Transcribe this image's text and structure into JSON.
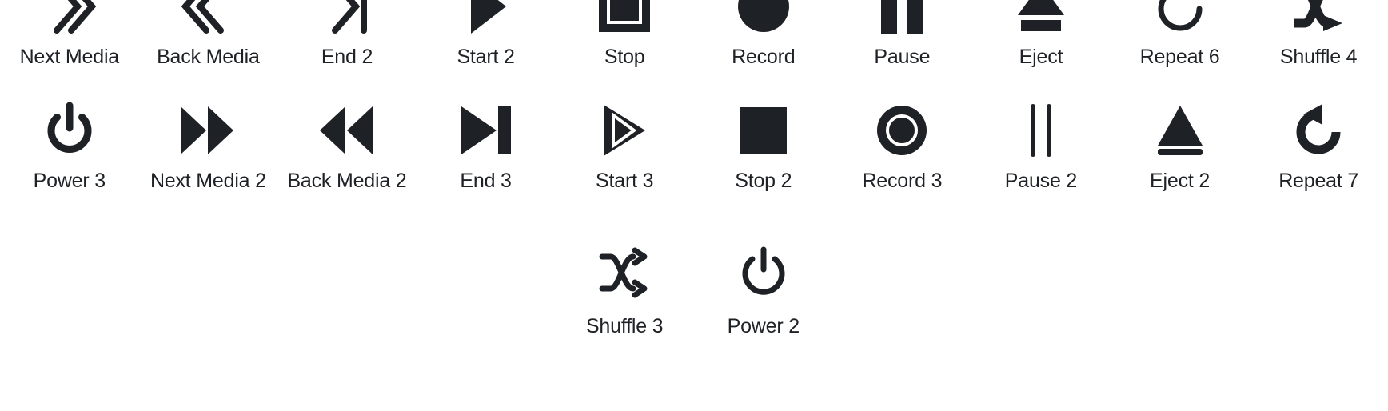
{
  "page": {
    "background_color": "#ffffff",
    "icon_color": "#1e2125",
    "label_color": "#1e2125",
    "columns": 10,
    "total_icons": 22
  },
  "rows": [
    {
      "row_index": 1,
      "cells": [
        {
          "icon": "next-media-chevron-double-right-icon",
          "label": "Next Media"
        },
        {
          "icon": "back-media-chevron-double-left-icon",
          "label": "Back Media"
        },
        {
          "icon": "end-chevron-right-bar-icon",
          "label": "End 2"
        },
        {
          "icon": "start-play-triangle-icon",
          "label": "Start 2"
        },
        {
          "icon": "stop-square-outline-inset-icon",
          "label": "Stop"
        },
        {
          "icon": "record-filled-circle-icon",
          "label": "Record"
        },
        {
          "icon": "pause-two-bars-icon",
          "label": "Pause"
        },
        {
          "icon": "eject-triangle-bar-icon",
          "label": "Eject"
        },
        {
          "icon": "repeat-counterclockwise-arrow-thin-icon",
          "label": "Repeat 6"
        },
        {
          "icon": "shuffle-crossed-arrows-bold-icon",
          "label": "Shuffle 4"
        }
      ]
    },
    {
      "row_index": 2,
      "cells": [
        {
          "icon": "power-symbol-thick-icon",
          "label": "Power 3"
        },
        {
          "icon": "next-media-double-triangle-icon",
          "label": "Next Media 2"
        },
        {
          "icon": "back-media-double-triangle-icon",
          "label": "Back Media 2"
        },
        {
          "icon": "end-triangle-bar-icon",
          "label": "End 3"
        },
        {
          "icon": "start-triangle-outline-inset-icon",
          "label": "Start 3"
        },
        {
          "icon": "stop-filled-square-icon",
          "label": "Stop 2"
        },
        {
          "icon": "record-circle-ring-inset-icon",
          "label": "Record 3"
        },
        {
          "icon": "pause-two-thin-lines-icon",
          "label": "Pause 2"
        },
        {
          "icon": "eject-tall-triangle-thin-bar-icon",
          "label": "Eject 2"
        },
        {
          "icon": "repeat-counterclockwise-arrow-bold-icon",
          "label": "Repeat 7"
        }
      ]
    },
    {
      "row_index": 3,
      "cells": [
        {
          "icon": "shuffle-crossed-arrows-thin-icon",
          "label": "Shuffle 3"
        },
        {
          "icon": "power-symbol-thin-icon",
          "label": "Power 2"
        }
      ],
      "leading_empty_columns": 4
    }
  ]
}
